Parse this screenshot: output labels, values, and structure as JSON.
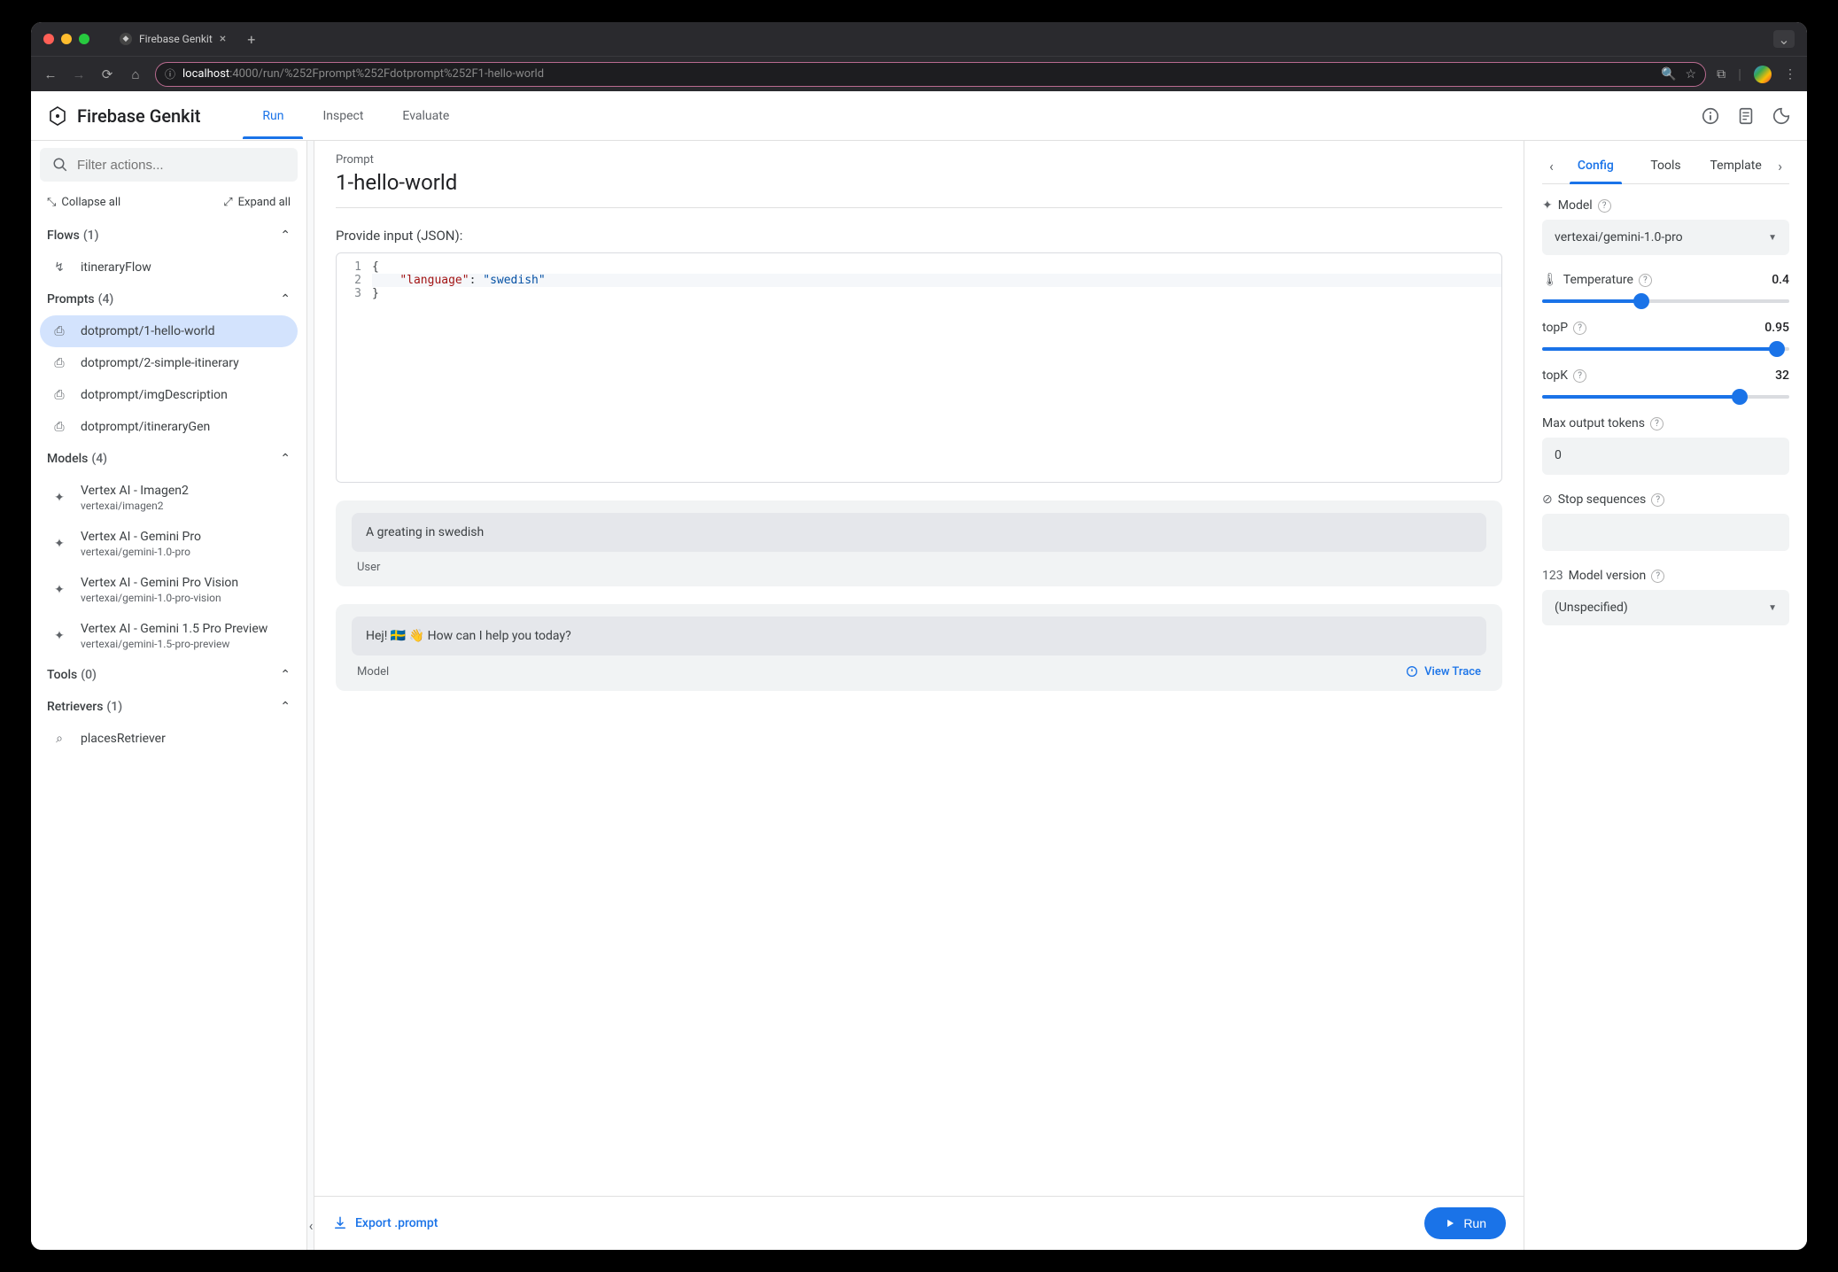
{
  "browser": {
    "tab_title": "Firebase Genkit",
    "url_host": "localhost",
    "url_port": ":4000",
    "url_path": "/run/%252Fprompt%252Fdotprompt%252F1-hello-world"
  },
  "header": {
    "brand": "Firebase Genkit",
    "tabs": [
      "Run",
      "Inspect",
      "Evaluate"
    ],
    "active_tab": 0
  },
  "sidebar": {
    "search_placeholder": "Filter actions...",
    "collapse_all": "Collapse all",
    "expand_all": "Expand all",
    "sections": {
      "flows": {
        "title": "Flows",
        "count": "(1)",
        "items": [
          {
            "label": "itineraryFlow"
          }
        ]
      },
      "prompts": {
        "title": "Prompts",
        "count": "(4)",
        "items": [
          {
            "label": "dotprompt/1-hello-world",
            "selected": true
          },
          {
            "label": "dotprompt/2-simple-itinerary"
          },
          {
            "label": "dotprompt/imgDescription"
          },
          {
            "label": "dotprompt/itineraryGen"
          }
        ]
      },
      "models": {
        "title": "Models",
        "count": "(4)",
        "items": [
          {
            "label": "Vertex AI - Imagen2",
            "sub": "vertexai/imagen2"
          },
          {
            "label": "Vertex AI - Gemini Pro",
            "sub": "vertexai/gemini-1.0-pro"
          },
          {
            "label": "Vertex AI - Gemini Pro Vision",
            "sub": "vertexai/gemini-1.0-pro-vision"
          },
          {
            "label": "Vertex AI - Gemini 1.5 Pro Preview",
            "sub": "vertexai/gemini-1.5-pro-preview"
          }
        ]
      },
      "tools": {
        "title": "Tools",
        "count": "(0)",
        "items": []
      },
      "retrievers": {
        "title": "Retrievers",
        "count": "(1)",
        "items": [
          {
            "label": "placesRetriever"
          }
        ]
      }
    }
  },
  "main": {
    "breadcrumb": "Prompt",
    "title": "1-hello-world",
    "input_label": "Provide input (JSON):",
    "json": {
      "line1": "{",
      "line2_key": "\"language\"",
      "line2_sep": ": ",
      "line2_val": "\"swedish\"",
      "line3": "}"
    },
    "card1_text": "A greating in swedish",
    "card1_role": "User",
    "card2_text": "Hej! 🇸🇪 👋 How can I help you today?",
    "card2_role": "Model",
    "view_trace": "View Trace",
    "export_label": "Export .prompt",
    "run_label": "Run"
  },
  "config": {
    "tabs": [
      "Config",
      "Tools",
      "Template"
    ],
    "active_tab": 0,
    "model_label": "Model",
    "model_value": "vertexai/gemini-1.0-pro",
    "temperature_label": "Temperature",
    "temperature_value": "0.4",
    "temperature_pct": 40,
    "topp_label": "topP",
    "topp_value": "0.95",
    "topp_pct": 95,
    "topk_label": "topK",
    "topk_value": "32",
    "topk_pct": 80,
    "max_tokens_label": "Max output tokens",
    "max_tokens_value": "0",
    "stop_label": "Stop sequences",
    "version_label": "Model version",
    "version_value": "(Unspecified)"
  }
}
